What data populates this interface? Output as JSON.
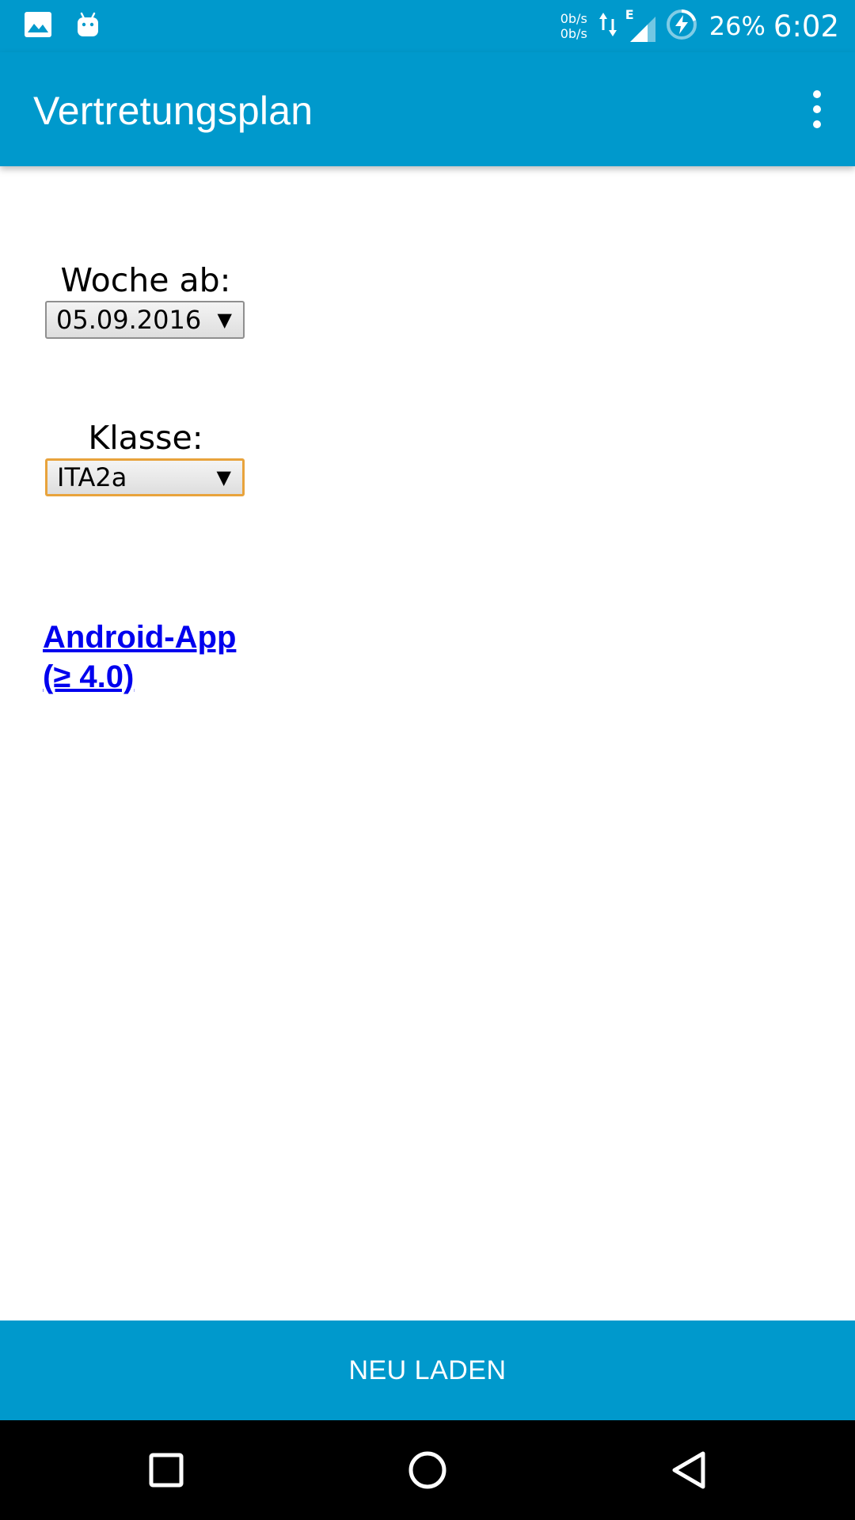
{
  "status_bar": {
    "icons": [
      "image-icon",
      "android-icon"
    ],
    "net_up": "0b/s",
    "net_down": "0b/s",
    "network_type": "E",
    "battery_percent": "26%",
    "time": "6:02"
  },
  "app_bar": {
    "title": "Vertretungsplan",
    "menu_icon": "more-vert-icon"
  },
  "form": {
    "week_label": "Woche ab:",
    "week_value": "05.09.2016",
    "class_label": "Klasse:",
    "class_value": "ITA2a",
    "caret": "▼"
  },
  "link": {
    "line1": "Android-App",
    "line2": "(≥ 4.0)"
  },
  "reload_button": {
    "label": "NEU LADEN"
  },
  "nav_bar": {
    "buttons": [
      "recents-icon",
      "home-icon",
      "back-icon"
    ]
  },
  "colors": {
    "primary": "#0099cc",
    "link": "#0000ee",
    "focus_border": "#e8a33c"
  }
}
